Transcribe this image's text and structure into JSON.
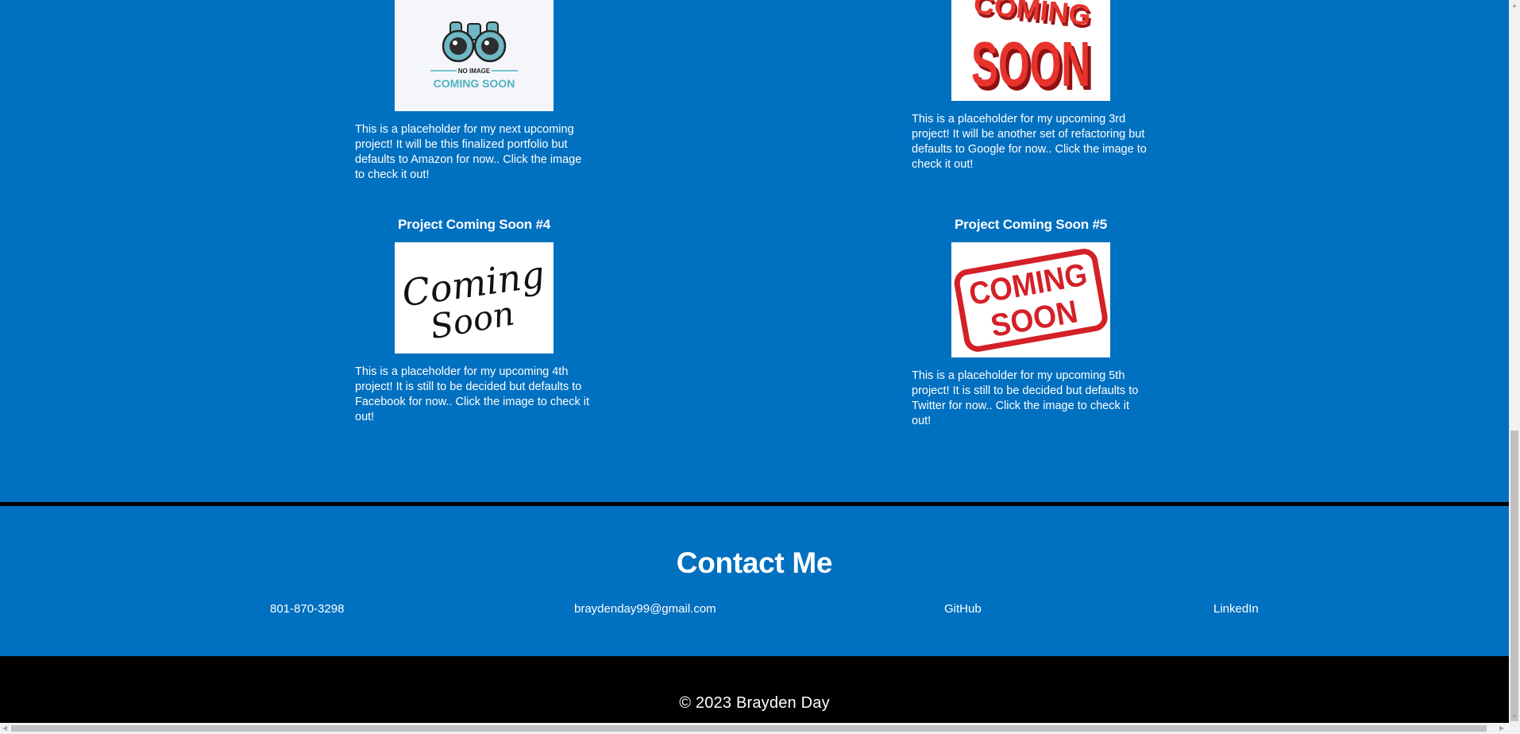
{
  "projects": [
    {
      "image_text": [
        "NO IMAGE",
        "COMING SOON"
      ],
      "description": "This is a placeholder for my next upcoming project! It will be this finalized portfolio but defaults to Amazon for now.. Click the image to check it out!"
    },
    {
      "image_text": [
        "COMING",
        "SOON"
      ],
      "description": "This is a placeholder for my upcoming 3rd project! It will be another set of refactoring but defaults to Google for now.. Click the image to check it out!"
    },
    {
      "title": "Project Coming Soon #4",
      "image_text": [
        "Coming",
        "Soon"
      ],
      "description": "This is a placeholder for my upcoming 4th project! It is still to be decided but defaults to Facebook for now.. Click the image to check it out!"
    },
    {
      "title": "Project Coming Soon #5",
      "image_text": [
        "COMING",
        "SOON"
      ],
      "description": "This is a placeholder for my upcoming 5th project! It is still to be decided but defaults to Twitter for now.. Click the image to check it out!"
    }
  ],
  "contact": {
    "title": "Contact Me",
    "phone": "801-870-3298",
    "email": "braydenday99@gmail.com",
    "github": "GitHub",
    "linkedin": "LinkedIn"
  },
  "footer": {
    "copyright": "© 2023 Brayden Day"
  },
  "colors": {
    "page_bg": "#0070c0",
    "footer_bg": "#000000",
    "text": "#ffffff",
    "teal": "#4fb3bf",
    "red": "#d42027"
  },
  "icons": {
    "binoculars": "binoculars-icon"
  }
}
